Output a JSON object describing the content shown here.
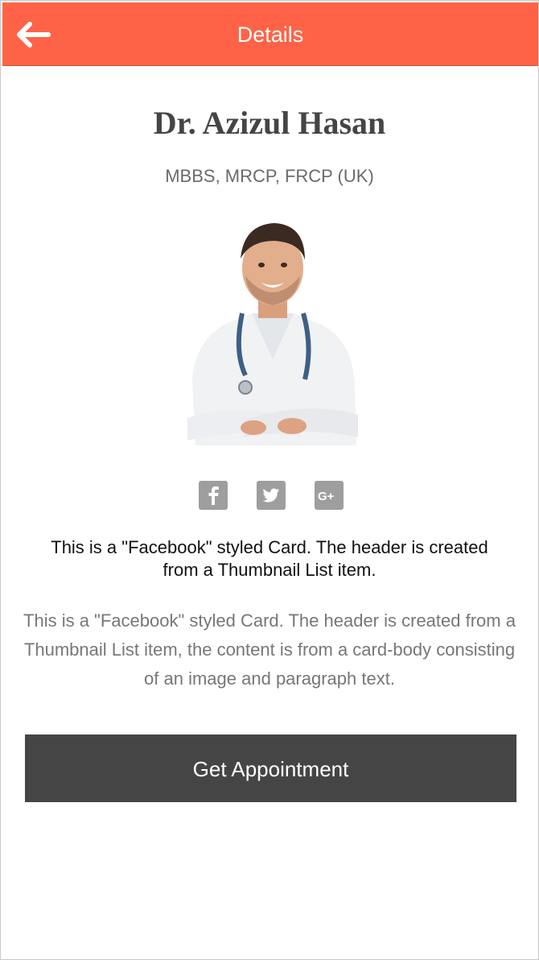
{
  "header": {
    "title": "Details",
    "back_icon": "arrow-left-icon"
  },
  "doctor": {
    "name": "Dr. Azizul Hasan",
    "credentials": "MBBS, MRCP, FRCP (UK)"
  },
  "social": [
    {
      "name": "facebook-icon",
      "glyph": "f"
    },
    {
      "name": "twitter-icon",
      "glyph": "t"
    },
    {
      "name": "google-plus-icon",
      "glyph": "G+"
    }
  ],
  "card": {
    "title": "This is a \"Facebook\" styled Card. The header is created from a Thumbnail List item.",
    "body": "This is a \"Facebook\" styled Card. The header is created from a Thumbnail List item, the content is from a card-body consisting of an image and paragraph text."
  },
  "actions": {
    "appointment_label": "Get Appointment"
  },
  "colors": {
    "header_bg": "#ff6347",
    "button_bg": "#454545",
    "icon_gray": "#9e9e9e"
  }
}
